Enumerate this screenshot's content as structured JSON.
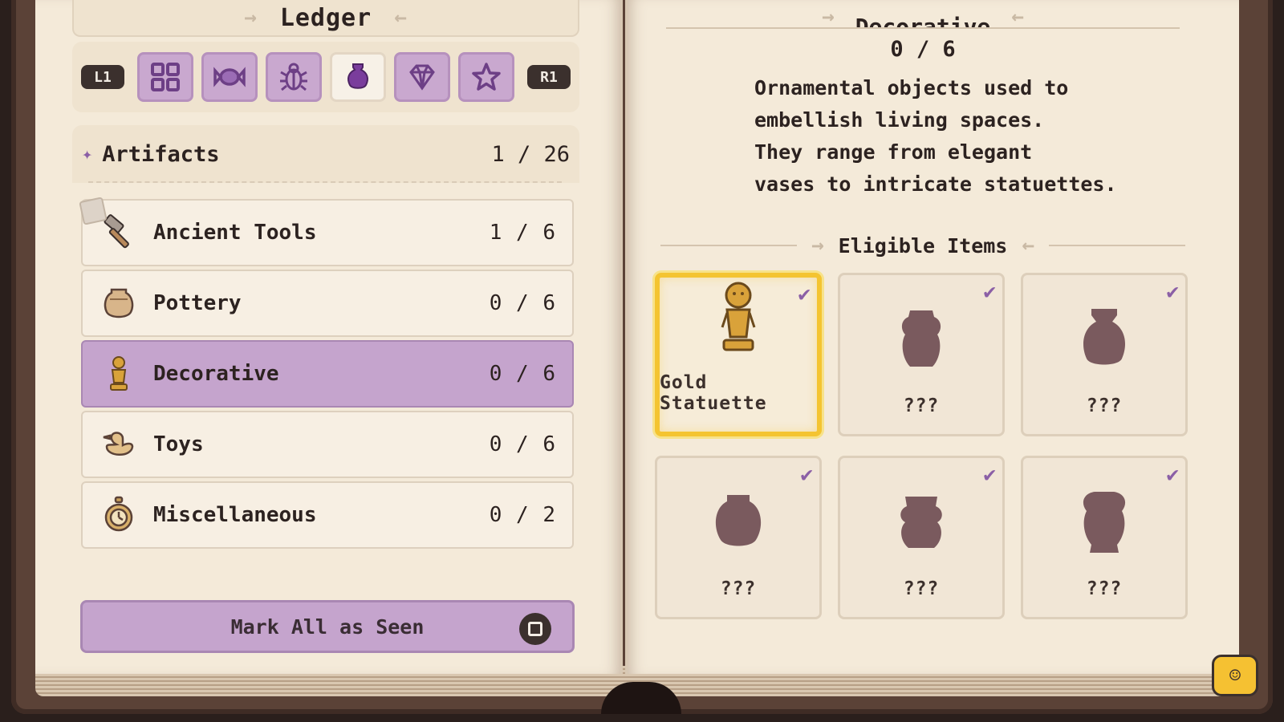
{
  "ledger": {
    "title": "Ledger",
    "shoulder_left": "L1",
    "shoulder_right": "R1",
    "tabs": [
      {
        "icon": "grid-icon"
      },
      {
        "icon": "candy-icon"
      },
      {
        "icon": "bug-icon"
      },
      {
        "icon": "vase-icon",
        "active": true
      },
      {
        "icon": "diamond-icon"
      },
      {
        "icon": "star-icon"
      }
    ]
  },
  "category": {
    "name": "Artifacts",
    "count": "1 / 26",
    "rows": [
      {
        "label": "Ancient Tools",
        "count": "1 / 6",
        "icon": "hammer-icon"
      },
      {
        "label": "Pottery",
        "count": "0 / 6",
        "icon": "pot-icon"
      },
      {
        "label": "Decorative",
        "count": "0 / 6",
        "icon": "statuette-icon",
        "active": true
      },
      {
        "label": "Toys",
        "count": "0 / 6",
        "icon": "duck-icon"
      },
      {
        "label": "Miscellaneous",
        "count": "0 / 2",
        "icon": "pocket-watch-icon"
      }
    ]
  },
  "mark_button": {
    "label": "Mark All as Seen",
    "glyph": "square-button-icon"
  },
  "detail": {
    "title": "Decorative",
    "count": "0 / 6",
    "description": [
      "Ornamental objects used to",
      "embellish living spaces.",
      "They range from elegant",
      "vases to intricate statuettes."
    ],
    "eligible_label": "Eligible Items",
    "items": [
      {
        "label": "Gold Statuette",
        "known": true,
        "selected": true
      },
      {
        "label": "???",
        "known": false
      },
      {
        "label": "???",
        "known": false
      },
      {
        "label": "???",
        "known": false
      },
      {
        "label": "???",
        "known": false
      },
      {
        "label": "???",
        "known": false
      }
    ]
  },
  "colors": {
    "accent_purple": "#c5a4cd",
    "selected_gold": "#f4c431",
    "silhouette": "#7a5a5e",
    "page": "#f4ead9"
  }
}
